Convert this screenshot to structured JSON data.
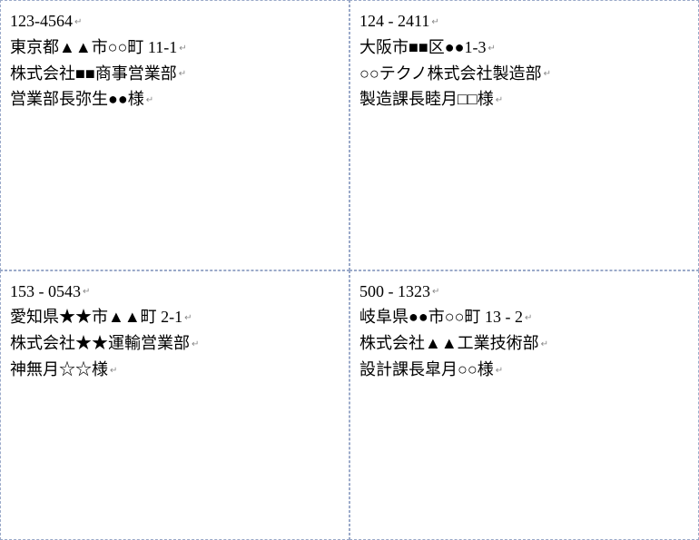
{
  "labels": [
    {
      "lines": [
        "123-4564",
        "東京都▲▲市○○町 11-1",
        "株式会社■■商事営業部",
        "営業部長弥生●●様"
      ]
    },
    {
      "lines": [
        "124 - 2411",
        "大阪市■■区●●1-3",
        "○○テクノ株式会社製造部",
        "製造課長睦月□□様"
      ]
    },
    {
      "lines": [
        "153 - 0543",
        "愛知県★★市▲▲町 2-1",
        "株式会社★★運輸営業部",
        "神無月☆☆様"
      ]
    },
    {
      "lines": [
        "500 - 1323",
        "岐阜県●●市○○町 13 - 2",
        "株式会社▲▲工業技術部",
        "設計課長皐月○○様"
      ]
    }
  ],
  "paragraph_mark": "↵"
}
